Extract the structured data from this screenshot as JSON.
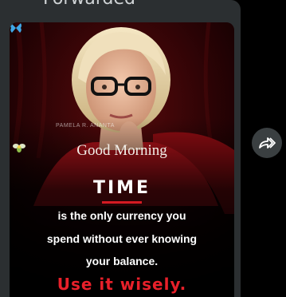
{
  "message": {
    "forwarded_label": "Forwarded",
    "image": {
      "watermark": "PAMELA R. ANANTA",
      "greeting_word1": "Good",
      "greeting_word2": "Morning",
      "headline": "TIME",
      "quote_lines": [
        "is the only currency you",
        "spend without ever knowing",
        "your balance."
      ],
      "call_to_action": "Use it wisely."
    }
  },
  "actions": {
    "share_icon": "forward-share-icon"
  },
  "colors": {
    "background": "#000000",
    "bubble": "#2b2f31",
    "accent_red": "#e8202a",
    "butterfly_blue": "#3fa7e6"
  }
}
